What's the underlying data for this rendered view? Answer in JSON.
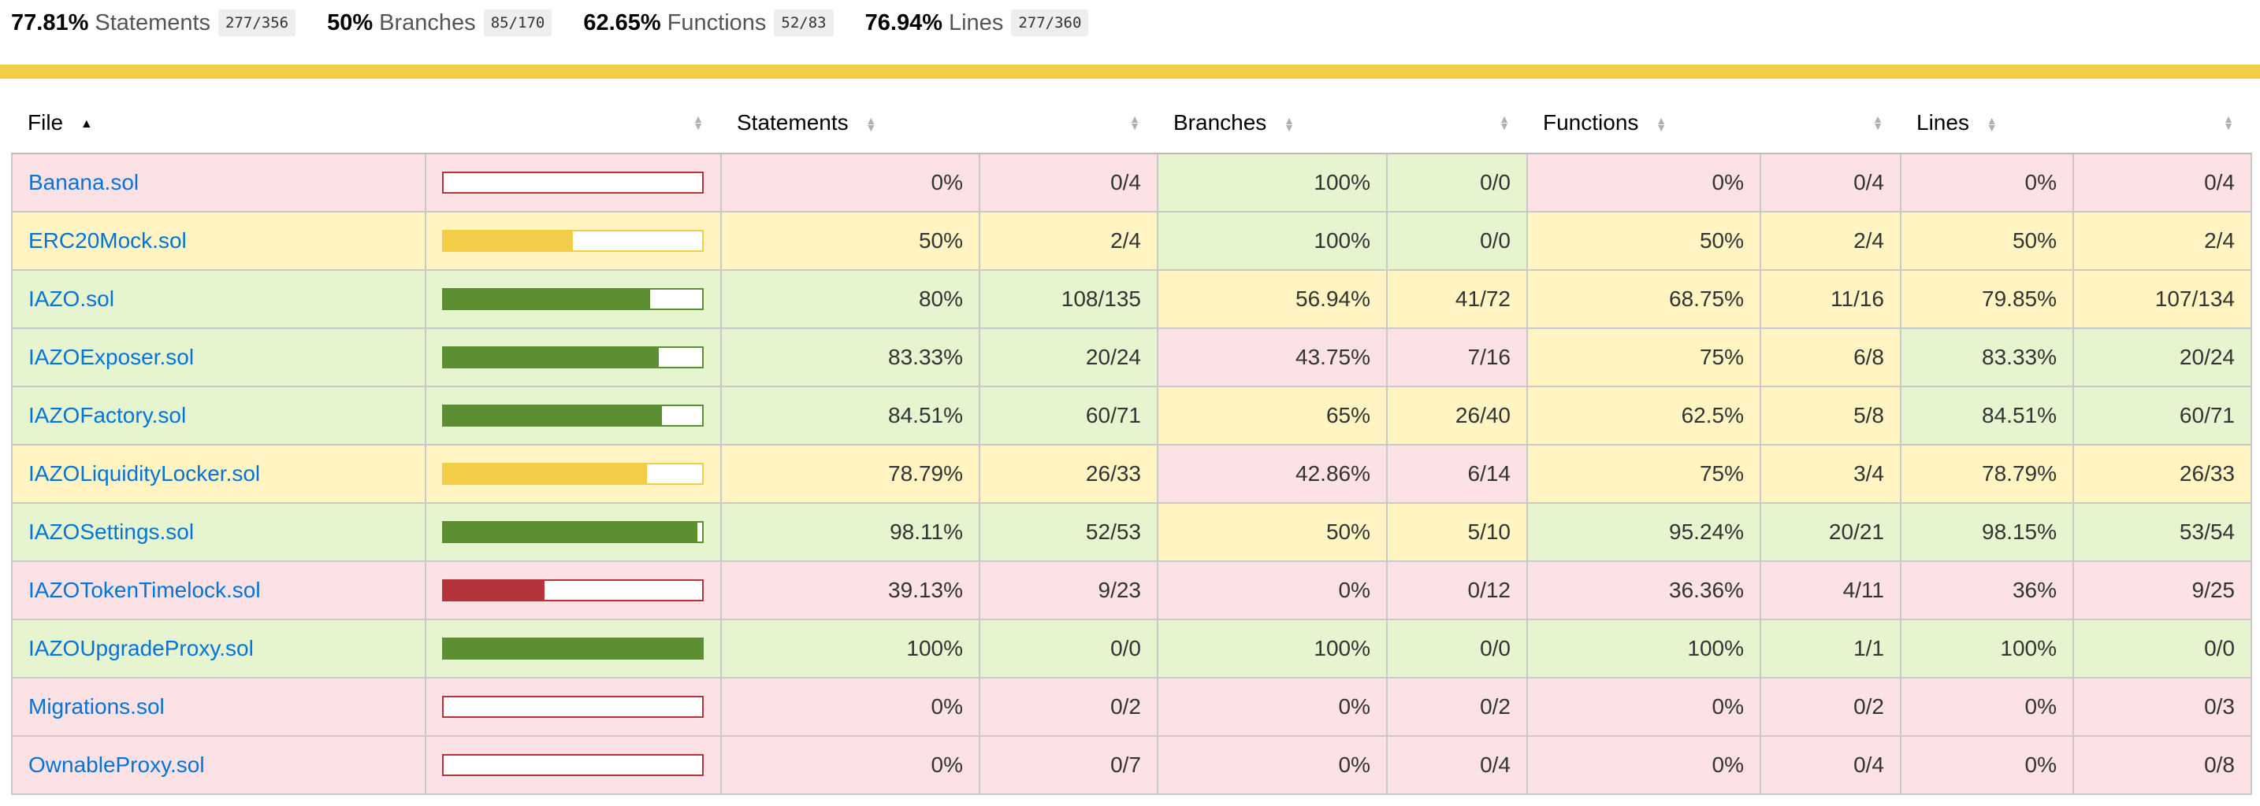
{
  "summary": {
    "statements": {
      "pct": "77.81%",
      "label": "Statements",
      "fraction": "277/356"
    },
    "branches": {
      "pct": "50%",
      "label": "Branches",
      "fraction": "85/170"
    },
    "functions": {
      "pct": "62.65%",
      "label": "Functions",
      "fraction": "52/83"
    },
    "lines": {
      "pct": "76.94%",
      "label": "Lines",
      "fraction": "277/360"
    }
  },
  "status_line_color": "#f2cd48",
  "colors": {
    "low_bg": "#fce1e5",
    "medium_bg": "#fff4c2",
    "high_bg": "#e6f5d0",
    "bar_low": "#b5343c",
    "bar_medium": "#f3cd48",
    "bar_high": "#5b8f32",
    "bar_empty_border": "#b5343c"
  },
  "table": {
    "headers": {
      "file": "File",
      "statements": "Statements",
      "branches": "Branches",
      "functions": "Functions",
      "lines": "Lines"
    },
    "rows": [
      {
        "file": "Banana.sol",
        "bar_pct": 0,
        "stmt_level": "low",
        "statements_pct": "0%",
        "statements_frac": "0/4",
        "branches_level": "high",
        "branches_pct": "100%",
        "branches_frac": "0/0",
        "functions_level": "low",
        "functions_pct": "0%",
        "functions_frac": "0/4",
        "lines_level": "low",
        "lines_pct": "0%",
        "lines_frac": "0/4"
      },
      {
        "file": "ERC20Mock.sol",
        "bar_pct": 50,
        "stmt_level": "medium",
        "statements_pct": "50%",
        "statements_frac": "2/4",
        "branches_level": "high",
        "branches_pct": "100%",
        "branches_frac": "0/0",
        "functions_level": "medium",
        "functions_pct": "50%",
        "functions_frac": "2/4",
        "lines_level": "medium",
        "lines_pct": "50%",
        "lines_frac": "2/4"
      },
      {
        "file": "IAZO.sol",
        "bar_pct": 80,
        "stmt_level": "high",
        "statements_pct": "80%",
        "statements_frac": "108/135",
        "branches_level": "medium",
        "branches_pct": "56.94%",
        "branches_frac": "41/72",
        "functions_level": "medium",
        "functions_pct": "68.75%",
        "functions_frac": "11/16",
        "lines_level": "medium",
        "lines_pct": "79.85%",
        "lines_frac": "107/134"
      },
      {
        "file": "IAZOExposer.sol",
        "bar_pct": 83.33,
        "stmt_level": "high",
        "statements_pct": "83.33%",
        "statements_frac": "20/24",
        "branches_level": "low",
        "branches_pct": "43.75%",
        "branches_frac": "7/16",
        "functions_level": "medium",
        "functions_pct": "75%",
        "functions_frac": "6/8",
        "lines_level": "high",
        "lines_pct": "83.33%",
        "lines_frac": "20/24"
      },
      {
        "file": "IAZOFactory.sol",
        "bar_pct": 84.51,
        "stmt_level": "high",
        "statements_pct": "84.51%",
        "statements_frac": "60/71",
        "branches_level": "medium",
        "branches_pct": "65%",
        "branches_frac": "26/40",
        "functions_level": "medium",
        "functions_pct": "62.5%",
        "functions_frac": "5/8",
        "lines_level": "high",
        "lines_pct": "84.51%",
        "lines_frac": "60/71"
      },
      {
        "file": "IAZOLiquidityLocker.sol",
        "bar_pct": 78.79,
        "stmt_level": "medium",
        "statements_pct": "78.79%",
        "statements_frac": "26/33",
        "branches_level": "low",
        "branches_pct": "42.86%",
        "branches_frac": "6/14",
        "functions_level": "medium",
        "functions_pct": "75%",
        "functions_frac": "3/4",
        "lines_level": "medium",
        "lines_pct": "78.79%",
        "lines_frac": "26/33"
      },
      {
        "file": "IAZOSettings.sol",
        "bar_pct": 98.11,
        "stmt_level": "high",
        "statements_pct": "98.11%",
        "statements_frac": "52/53",
        "branches_level": "medium",
        "branches_pct": "50%",
        "branches_frac": "5/10",
        "functions_level": "high",
        "functions_pct": "95.24%",
        "functions_frac": "20/21",
        "lines_level": "high",
        "lines_pct": "98.15%",
        "lines_frac": "53/54"
      },
      {
        "file": "IAZOTokenTimelock.sol",
        "bar_pct": 39.13,
        "stmt_level": "low",
        "statements_pct": "39.13%",
        "statements_frac": "9/23",
        "branches_level": "low",
        "branches_pct": "0%",
        "branches_frac": "0/12",
        "functions_level": "low",
        "functions_pct": "36.36%",
        "functions_frac": "4/11",
        "lines_level": "low",
        "lines_pct": "36%",
        "lines_frac": "9/25"
      },
      {
        "file": "IAZOUpgradeProxy.sol",
        "bar_pct": 100,
        "stmt_level": "high",
        "statements_pct": "100%",
        "statements_frac": "0/0",
        "branches_level": "high",
        "branches_pct": "100%",
        "branches_frac": "0/0",
        "functions_level": "high",
        "functions_pct": "100%",
        "functions_frac": "1/1",
        "lines_level": "high",
        "lines_pct": "100%",
        "lines_frac": "0/0"
      },
      {
        "file": "Migrations.sol",
        "bar_pct": 0,
        "stmt_level": "low",
        "statements_pct": "0%",
        "statements_frac": "0/2",
        "branches_level": "low",
        "branches_pct": "0%",
        "branches_frac": "0/2",
        "functions_level": "low",
        "functions_pct": "0%",
        "functions_frac": "0/2",
        "lines_level": "low",
        "lines_pct": "0%",
        "lines_frac": "0/3"
      },
      {
        "file": "OwnableProxy.sol",
        "bar_pct": 0,
        "stmt_level": "low",
        "statements_pct": "0%",
        "statements_frac": "0/7",
        "branches_level": "low",
        "branches_pct": "0%",
        "branches_frac": "0/4",
        "functions_level": "low",
        "functions_pct": "0%",
        "functions_frac": "0/4",
        "lines_level": "low",
        "lines_pct": "0%",
        "lines_frac": "0/8"
      }
    ]
  }
}
